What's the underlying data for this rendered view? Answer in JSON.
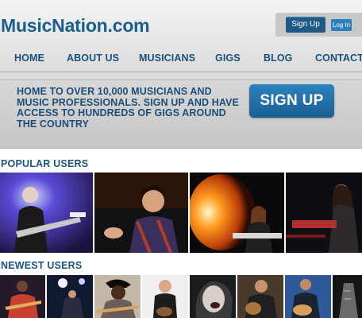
{
  "header": {
    "logo": "MusicNation.com",
    "signup_label": "Sign Up",
    "login_label": "Log In"
  },
  "nav": {
    "items": [
      "HOME",
      "ABOUT US",
      "MUSICIANS",
      "GIGS",
      "BLOG",
      "CONTACT"
    ]
  },
  "hero": {
    "text": "HOME TO OVER 10,000 MUSICIANS AND MUSIC PROFESSIONALS. SIGN UP AND HAVE ACCESS TO HUNDREDS OF GIGS AROUND THE COUNTRY",
    "cta_label": "SIGN UP"
  },
  "popular": {
    "title": "POPULAR USERS"
  },
  "newest": {
    "title": "NEWEST USERS"
  },
  "colors": {
    "brand": "#1b5f8c",
    "button": "#1d5a86",
    "cta": "#2a7fc0"
  }
}
